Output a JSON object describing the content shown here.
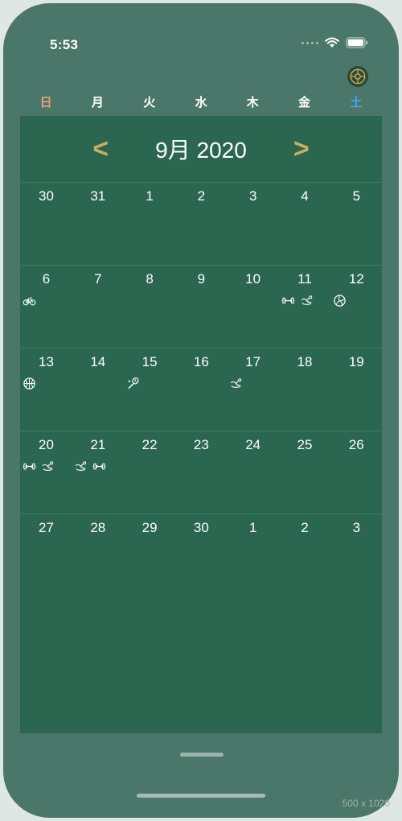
{
  "status": {
    "time": "5:53"
  },
  "weekdays": [
    {
      "label": "日",
      "color": "#e8a27e"
    },
    {
      "label": "月",
      "color": "#ffffff"
    },
    {
      "label": "火",
      "color": "#ffffff"
    },
    {
      "label": "水",
      "color": "#ffffff"
    },
    {
      "label": "木",
      "color": "#ffffff"
    },
    {
      "label": "金",
      "color": "#ffffff"
    },
    {
      "label": "土",
      "color": "#42a9e6"
    }
  ],
  "calendar": {
    "month_title": "9月 2020",
    "prev_label": "<",
    "next_label": ">",
    "weeks": [
      [
        {
          "day": "30",
          "icons": []
        },
        {
          "day": "31",
          "icons": []
        },
        {
          "day": "1",
          "icons": []
        },
        {
          "day": "2",
          "icons": []
        },
        {
          "day": "3",
          "icons": []
        },
        {
          "day": "4",
          "icons": []
        },
        {
          "day": "5",
          "icons": []
        }
      ],
      [
        {
          "day": "6",
          "icons": [
            "bike-icon"
          ]
        },
        {
          "day": "7",
          "icons": []
        },
        {
          "day": "8",
          "icons": []
        },
        {
          "day": "9",
          "icons": []
        },
        {
          "day": "10",
          "icons": []
        },
        {
          "day": "11",
          "icons": [
            "dumbbell-icon",
            "swim-icon"
          ]
        },
        {
          "day": "12",
          "icons": [
            "volleyball-icon"
          ]
        }
      ],
      [
        {
          "day": "13",
          "icons": [
            "basketball-icon"
          ]
        },
        {
          "day": "14",
          "icons": []
        },
        {
          "day": "15",
          "icons": [
            "badminton-icon"
          ]
        },
        {
          "day": "16",
          "icons": []
        },
        {
          "day": "17",
          "icons": [
            "swim-icon"
          ]
        },
        {
          "day": "18",
          "icons": []
        },
        {
          "day": "19",
          "icons": []
        }
      ],
      [
        {
          "day": "20",
          "icons": [
            "dumbbell-icon",
            "swim-icon"
          ]
        },
        {
          "day": "21",
          "icons": [
            "swim-icon",
            "dumbbell-icon"
          ]
        },
        {
          "day": "22",
          "icons": []
        },
        {
          "day": "23",
          "icons": []
        },
        {
          "day": "24",
          "icons": []
        },
        {
          "day": "25",
          "icons": []
        },
        {
          "day": "26",
          "icons": []
        }
      ],
      [
        {
          "day": "27",
          "icons": []
        },
        {
          "day": "28",
          "icons": []
        },
        {
          "day": "29",
          "icons": []
        },
        {
          "day": "30",
          "icons": []
        },
        {
          "day": "1",
          "icons": []
        },
        {
          "day": "2",
          "icons": []
        },
        {
          "day": "3",
          "icons": []
        }
      ]
    ]
  },
  "footer": {
    "size_label": "500 x 1020"
  },
  "colors": {
    "gold": "#c9ad5f",
    "calendar_bg": "#2a6650",
    "page_bg": "#4a776a"
  }
}
